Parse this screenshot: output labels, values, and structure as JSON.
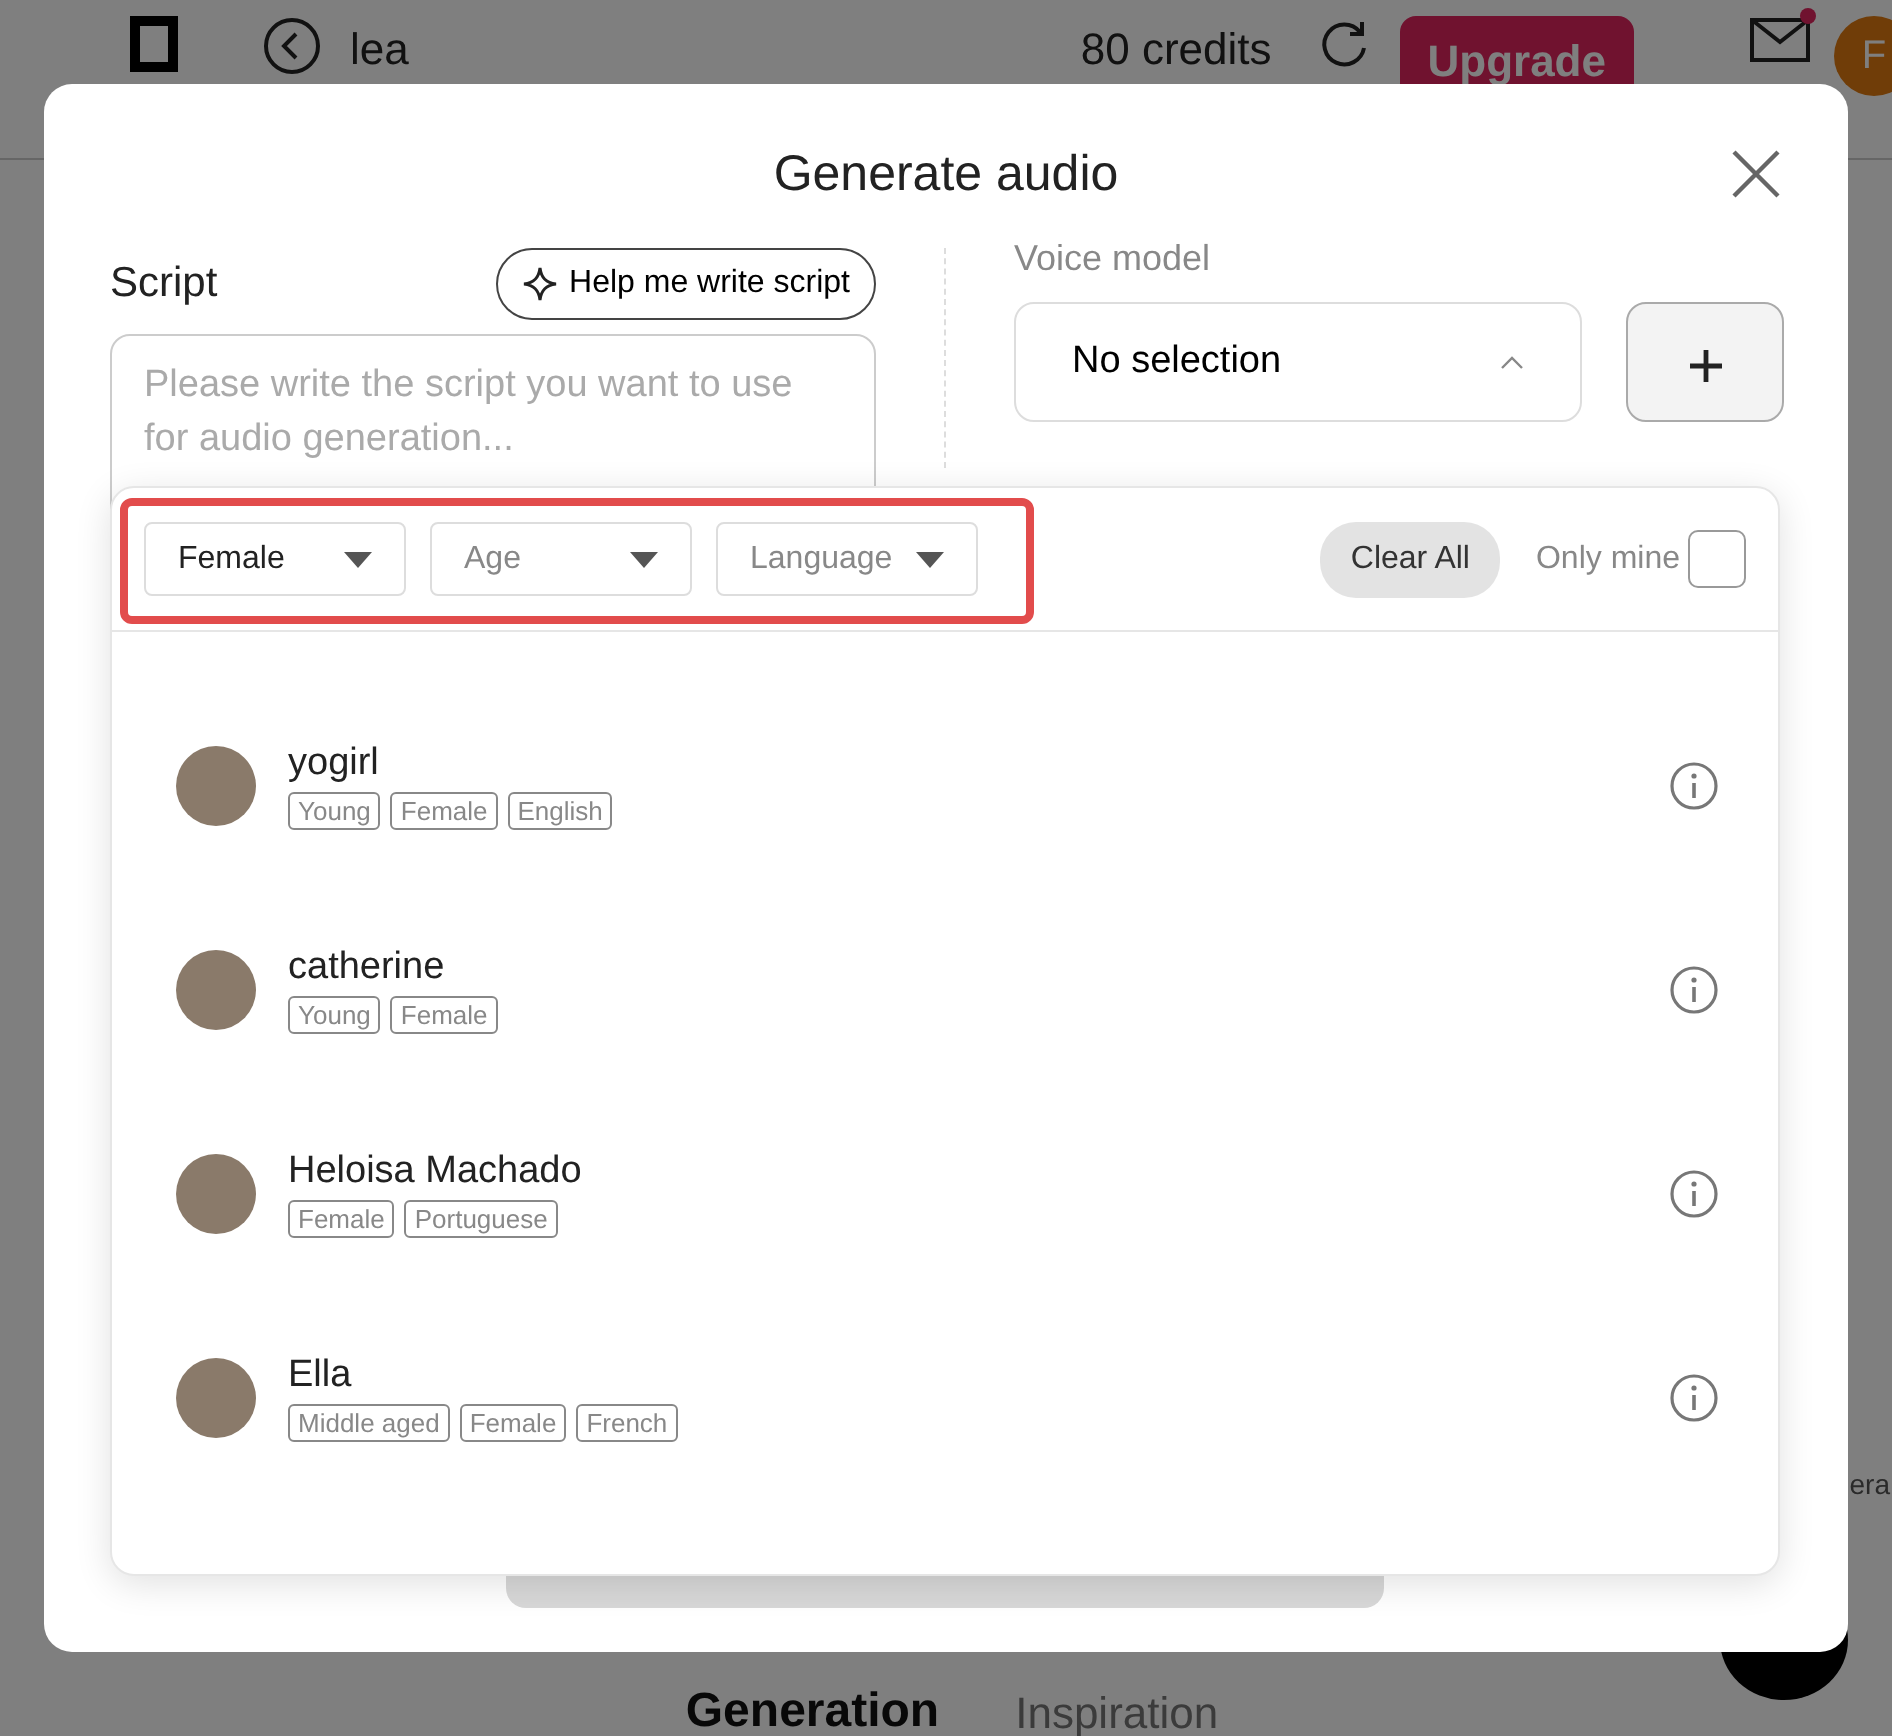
{
  "background_page": {
    "header": {
      "project_name": "lea",
      "credits": "80 credits",
      "upgrade_button": "Upgrade",
      "mail_unread": true,
      "avatar_initial": "F"
    },
    "side_text": "era",
    "tabs": [
      {
        "label": "Generation",
        "selected": true
      },
      {
        "label": "Inspiration",
        "selected": false
      }
    ]
  },
  "dialog": {
    "title": "Generate audio",
    "script": {
      "label": "Script",
      "help_button": "Help me write script",
      "placeholder": "Please write the script you want to use for audio generation..."
    },
    "voice_model": {
      "label": "Voice model",
      "value": "No selection",
      "expanded": true
    },
    "voice_picker": {
      "filters": [
        {
          "label": "Female",
          "selected": true
        },
        {
          "label": "Age",
          "selected": false
        },
        {
          "label": "Language",
          "selected": false
        }
      ],
      "clear_button": "Clear All",
      "only_mine": {
        "label": "Only mine",
        "checked": false
      },
      "voices": [
        {
          "name": "yogirl",
          "tags": [
            "Young",
            "Female",
            "English"
          ]
        },
        {
          "name": "catherine",
          "tags": [
            "Young",
            "Female"
          ]
        },
        {
          "name": "Heloisa Machado",
          "tags": [
            "Female",
            "Portuguese"
          ]
        },
        {
          "name": "Ella",
          "tags": [
            "Middle aged",
            "Female",
            "French"
          ]
        }
      ]
    }
  }
}
